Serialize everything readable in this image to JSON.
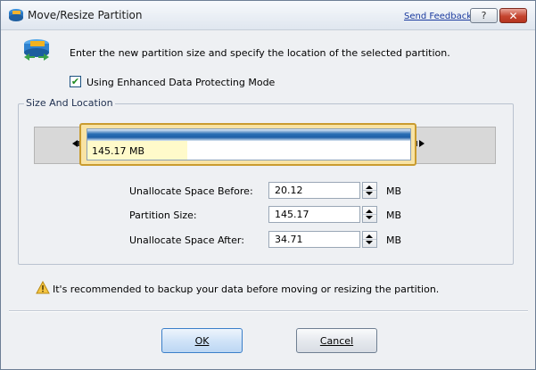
{
  "window": {
    "title": "Move/Resize Partition",
    "send_feedback": "Send Feedback",
    "help_label": "?",
    "close_label": "✕"
  },
  "intro_text": "Enter the new partition size and specify the location of the selected partition.",
  "enhanced_mode": {
    "label": "Using Enhanced Data Protecting Mode",
    "checked": true,
    "check_glyph": "✔"
  },
  "group": {
    "title": "Size And Location",
    "partition_label": "145.17 MB",
    "used_fraction": 0.31
  },
  "fields": [
    {
      "label": "Unallocate Space Before:",
      "value": "20.12",
      "unit": "MB"
    },
    {
      "label": "Partition Size:",
      "value": "145.17",
      "unit": "MB"
    },
    {
      "label": "Unallocate Space After:",
      "value": "34.71",
      "unit": "MB"
    }
  ],
  "warning_text": "It's recommended to backup your data before moving or resizing the partition.",
  "buttons": {
    "ok": "OK",
    "cancel": "Cancel"
  },
  "colors": {
    "accent_blue": "#1d5fa7",
    "partition_border": "#c99b2f",
    "partition_fill": "#f8e3a4",
    "used_fill": "#fffaca",
    "close_red": "#c4442f"
  },
  "icons": {
    "app": "partition-app-icon",
    "header": "move-resize-icon",
    "warning": "warning-icon"
  }
}
